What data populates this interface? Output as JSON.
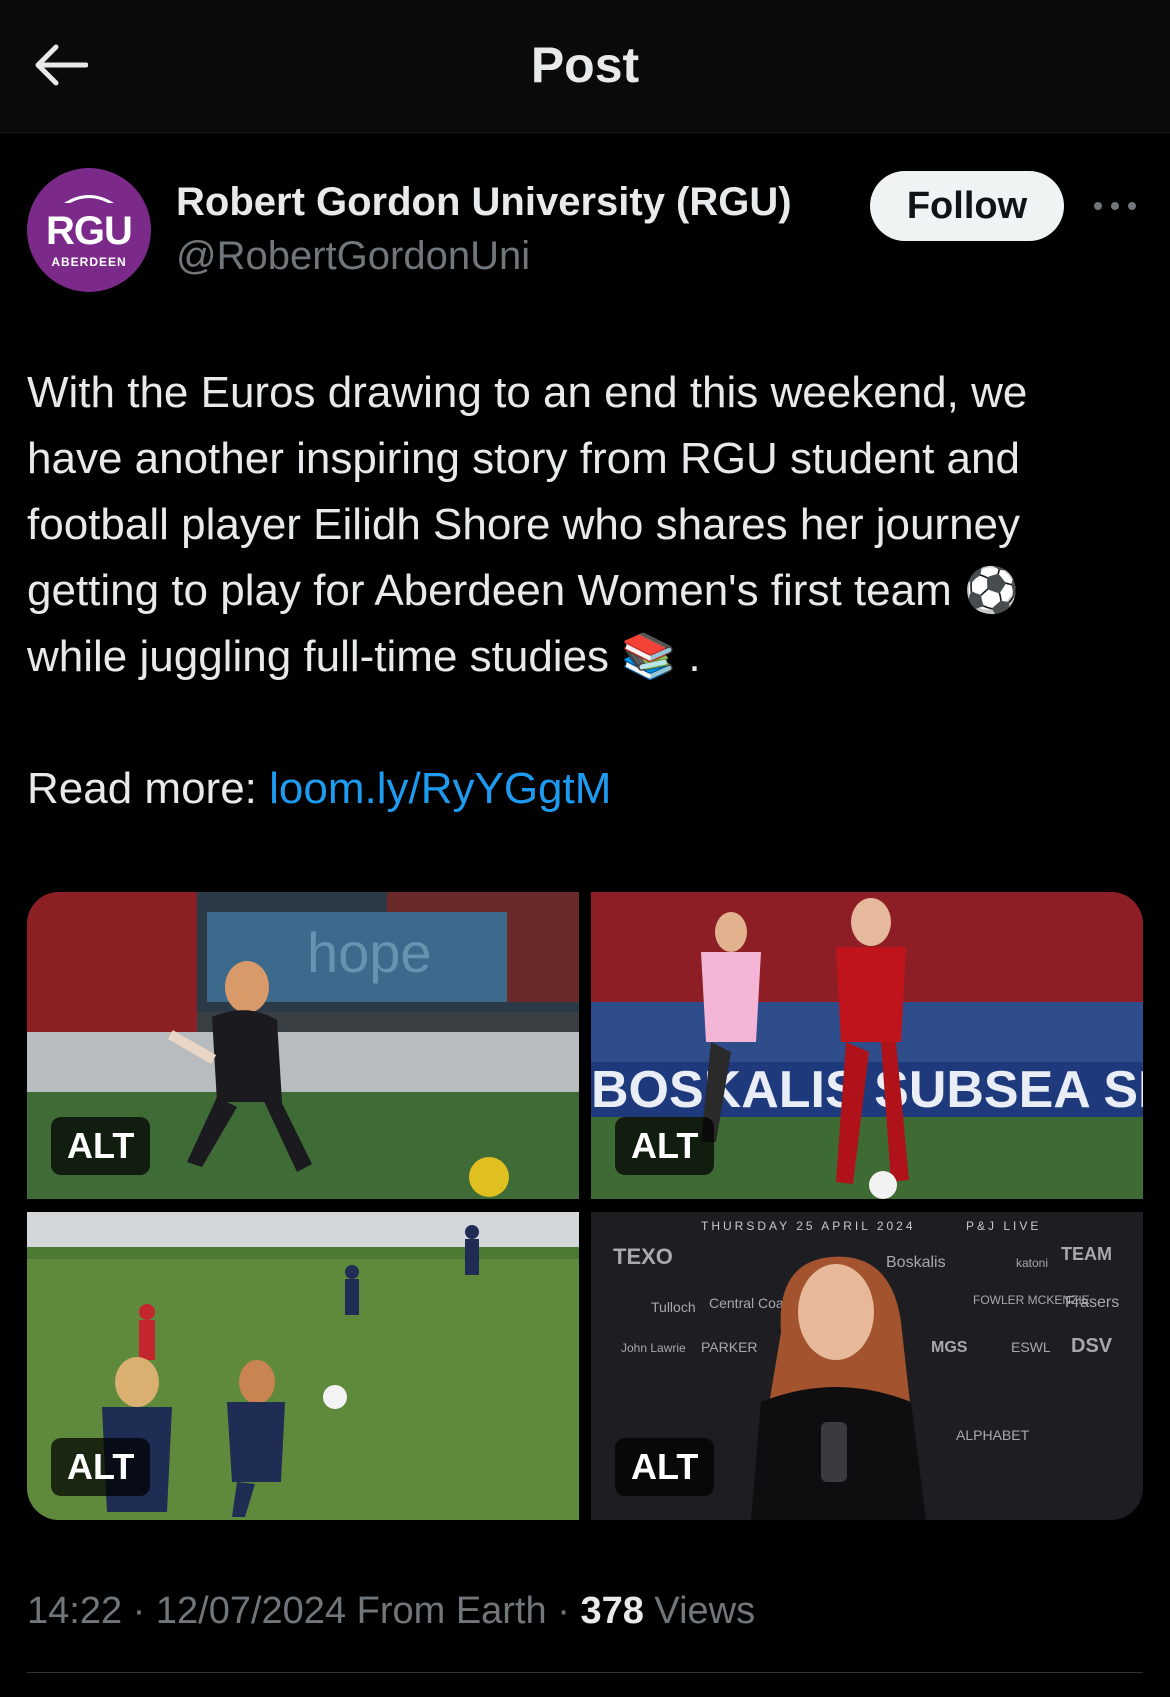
{
  "header": {
    "title": "Post"
  },
  "author": {
    "name": "Robert Gordon University (RGU)",
    "handle": "@RobertGordonUni",
    "avatar_text": "RGU",
    "avatar_subtext": "ABERDEEN",
    "avatar_color": "#7b2a8a"
  },
  "follow_label": "Follow",
  "post": {
    "line1": "With the Euros drawing to an end this weekend, we",
    "line2": "have another inspiring story from RGU student and",
    "line3": "football player Eilidh Shore who shares her journey",
    "line4": "getting to play for Aberdeen Women's first team",
    "line4_emoji": "⚽",
    "line5": "while juggling full-time studies",
    "line5_emoji": "📚",
    "line5_end": " .",
    "read_more_label": "Read more: ",
    "link": "loom.ly/RyYGgtM"
  },
  "media": {
    "alt_label": "ALT",
    "photo4": {
      "banner_left": "THURSDAY 25 APRIL 2024",
      "banner_right": "P&J LIVE",
      "sponsors": [
        "TEXO",
        "Boskalis",
        "TEAM",
        "Tulloch",
        "Central Coaches",
        "FOWLER MCKENZIE",
        "Frasers",
        "John Lawrie",
        "PARKER",
        "MGS",
        "ESWL",
        "DSV",
        "katoni",
        "ALPHABET"
      ]
    },
    "photo1": {
      "banner": "hope"
    },
    "photo2": {
      "banner": "BOSKALIS SUBSEA SERVIC"
    }
  },
  "meta": {
    "time": "14:22",
    "sep1": " · ",
    "date": "12/07/2024",
    "source": " From Earth",
    "sep2": " · ",
    "views_count": "378",
    "views_label": " Views"
  },
  "colors": {
    "link": "#1d9bf0",
    "muted": "#71767b",
    "follow_bg": "#eff3f4"
  }
}
